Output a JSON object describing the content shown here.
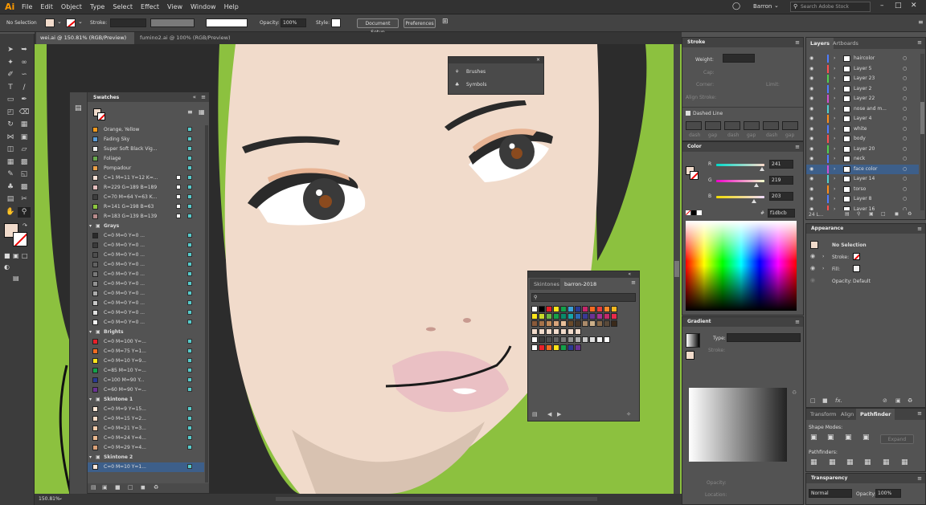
{
  "menubar": {
    "logo": "Ai",
    "items": [
      "File",
      "Edit",
      "Object",
      "Type",
      "Select",
      "Effect",
      "View",
      "Window",
      "Help"
    ],
    "user": "Barron",
    "search_placeholder": "Search Adobe Stock"
  },
  "control": {
    "selection": "No Selection",
    "stroke_label": "Stroke:",
    "opacity_label": "Opacity:",
    "opacity_value": "100%",
    "style_label": "Style:",
    "document_setup": "Document Setup",
    "preferences": "Preferences"
  },
  "tabs": [
    "wei.ai @ 150.81% (RGB/Preview)",
    "fumino2.ai @ 100% (RGB/Preview)"
  ],
  "status": {
    "zoom": "150.81%"
  },
  "brushes_panel": {
    "items": [
      "Brushes",
      "Symbols"
    ]
  },
  "swatches": {
    "title": "Swatches",
    "top": [
      {
        "name": "Orange, Yellow",
        "color": "#f29a1e"
      },
      {
        "name": "Fading Sky",
        "color": "#5b9bd5"
      },
      {
        "name": "Super Soft Black Vig...",
        "color": "#eeeeee"
      },
      {
        "name": "Foliage",
        "color": "#6aa84f"
      },
      {
        "name": "Pompadour",
        "color": "#e8a04a"
      }
    ],
    "colors": [
      {
        "name": "C=1 M=11 Y=12 K=...",
        "color": "#f6e0d4"
      },
      {
        "name": "R=229 G=189 B=189",
        "color": "#e5bdbd"
      },
      {
        "name": "C=70 M=64 Y=63 K...",
        "color": "#3d3d3d"
      },
      {
        "name": "R=141 G=198 B=63",
        "color": "#8dc63f"
      },
      {
        "name": "R=183 G=139 B=139",
        "color": "#b78b8b"
      }
    ],
    "groups": [
      {
        "name": "Grays",
        "items": [
          {
            "name": "C=0 M=0 Y=0 ...",
            "color": "#2a2a2a"
          },
          {
            "name": "C=0 M=0 Y=0 ...",
            "color": "#3a3a3a"
          },
          {
            "name": "C=0 M=0 Y=0 ...",
            "color": "#4e4e4e"
          },
          {
            "name": "C=0 M=0 Y=0 ...",
            "color": "#626262"
          },
          {
            "name": "C=0 M=0 Y=0 ...",
            "color": "#7a7a7a"
          },
          {
            "name": "C=0 M=0 Y=0 ...",
            "color": "#939393"
          },
          {
            "name": "C=0 M=0 Y=0 ...",
            "color": "#adadad"
          },
          {
            "name": "C=0 M=0 Y=0 ...",
            "color": "#c8c8c8"
          },
          {
            "name": "C=0 M=0 Y=0 ...",
            "color": "#e0e0e0"
          },
          {
            "name": "C=0 M=0 Y=0 ...",
            "color": "#f4f4f4"
          }
        ]
      },
      {
        "name": "Brights",
        "items": [
          {
            "name": "C=0 M=100 Y=...",
            "color": "#e8202a"
          },
          {
            "name": "C=0 M=75 Y=1...",
            "color": "#f26b22"
          },
          {
            "name": "C=0 M=10 Y=9...",
            "color": "#ffe51a"
          },
          {
            "name": "C=85 M=10 Y=...",
            "color": "#13a14a"
          },
          {
            "name": "C=100 M=90 Y...",
            "color": "#2a3a93"
          },
          {
            "name": "C=60 M=90 Y=...",
            "color": "#6a3393"
          }
        ]
      },
      {
        "name": "Skintone 1",
        "items": [
          {
            "name": "C=0 M=9 Y=15...",
            "color": "#fde9d8"
          },
          {
            "name": "C=0 M=15 Y=2...",
            "color": "#f8dcc6"
          },
          {
            "name": "C=0 M=21 Y=3...",
            "color": "#f2cbaa"
          },
          {
            "name": "C=0 M=24 Y=4...",
            "color": "#e9b88f"
          },
          {
            "name": "C=0 M=29 Y=4...",
            "color": "#d9a077"
          }
        ]
      },
      {
        "name": "Skintone 2",
        "items": [
          {
            "name": "C=0 M=10 Y=1...",
            "color": "#fbe8d9"
          }
        ]
      }
    ]
  },
  "skintones": {
    "tabs": [
      "Skintones",
      "barron-2018"
    ]
  },
  "stroke": {
    "title": "Stroke",
    "weight": "Weight:",
    "cap": "Cap:",
    "corner": "Corner:",
    "limit": "Limit:",
    "align": "Align Stroke:",
    "dashed": "Dashed Line",
    "dash": "dash",
    "gap": "gap"
  },
  "color": {
    "title": "Color",
    "r": "241",
    "g": "219",
    "b": "203",
    "hex": "f1dbcb",
    "swatch": "#f1dbcb"
  },
  "gradient": {
    "title": "Gradient",
    "type": "Type:",
    "stroke": "Stroke:",
    "opacity": "Opacity:",
    "location": "Location:"
  },
  "layers": {
    "tabs": [
      "Layers",
      "Artboards"
    ],
    "count": "24 L...",
    "items": [
      {
        "name": "haircolor",
        "color": "#4f7cff"
      },
      {
        "name": "Layer 5",
        "color": "#ff4f4f"
      },
      {
        "name": "Layer 23",
        "color": "#4fd14f"
      },
      {
        "name": "Layer 2",
        "color": "#4f7cff"
      },
      {
        "name": "Layer 22",
        "color": "#d14fd1"
      },
      {
        "name": "nose and m...",
        "color": "#4fd1d1"
      },
      {
        "name": "Layer 4",
        "color": "#ff8c1a"
      },
      {
        "name": "white",
        "color": "#4f7cff"
      },
      {
        "name": "body",
        "color": "#ff4f4f"
      },
      {
        "name": "Layer 20",
        "color": "#4fd14f"
      },
      {
        "name": "neck",
        "color": "#4f7cff"
      },
      {
        "name": "face color",
        "color": "#d14fd1",
        "selected": true
      },
      {
        "name": "Layer 14",
        "color": "#4fd1d1"
      },
      {
        "name": "torso",
        "color": "#ff8c1a"
      },
      {
        "name": "Layer 8",
        "color": "#4f7cff"
      },
      {
        "name": "Layer 16",
        "color": "#ff4f4f"
      }
    ]
  },
  "appearance": {
    "title": "Appearance",
    "selection": "No Selection",
    "stroke": "Stroke:",
    "fill": "Fill:",
    "opacity": "Opacity:",
    "opacity_value": "Default"
  },
  "pathfinder": {
    "tabs": [
      "Transform",
      "Align",
      "Pathfinder"
    ],
    "shape_modes": "Shape Modes:",
    "expand": "Expand",
    "pathfinders": "Pathfinders:"
  },
  "transparency": {
    "title": "Transparency",
    "mode": "Normal",
    "opacity_label": "Opacity:",
    "opacity": "100%"
  }
}
